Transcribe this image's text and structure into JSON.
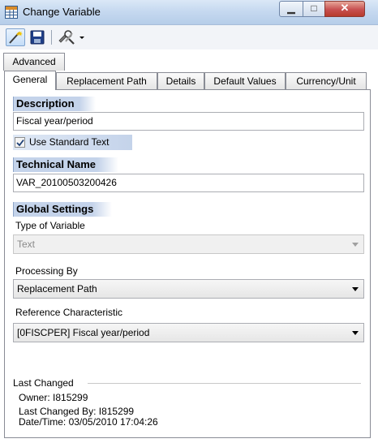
{
  "window": {
    "title": "Change Variable",
    "icons": [
      "app-table-icon",
      "minimize-icon",
      "maximize-icon",
      "close-icon"
    ]
  },
  "toolbar": {
    "icons": [
      "magic-wand-icon",
      "save-icon",
      "tools-dropdown-icon"
    ]
  },
  "tabs": {
    "row1": [
      {
        "label": "Advanced"
      }
    ],
    "row2": [
      {
        "label": "General",
        "selected": true
      },
      {
        "label": "Replacement Path"
      },
      {
        "label": "Details"
      },
      {
        "label": "Default Values"
      },
      {
        "label": "Currency/Unit"
      }
    ]
  },
  "general": {
    "description": {
      "header": "Description",
      "value": "Fiscal year/period",
      "use_standard_text_label": "Use Standard Text",
      "use_standard_text_checked": true
    },
    "technical_name": {
      "header": "Technical Name",
      "value": "VAR_20100503200426"
    },
    "global_settings": {
      "header": "Global Settings",
      "type_label": "Type of Variable",
      "type_value": "Text",
      "type_disabled": true,
      "processing_label": "Processing By",
      "processing_value": "Replacement Path",
      "reference_label": "Reference Characteristic",
      "reference_value": "[0FISCPER] Fiscal year/period"
    },
    "last_changed": {
      "header": "Last Changed",
      "owner": "Owner: I815299",
      "changed_by": "Last Changed By: I815299",
      "datetime": "Date/Time: 03/05/2010 17:04:26"
    }
  },
  "colors": {
    "section_header": "#c4d3ea",
    "titlebar": "#c6d9f0",
    "close_button": "#c75050"
  }
}
